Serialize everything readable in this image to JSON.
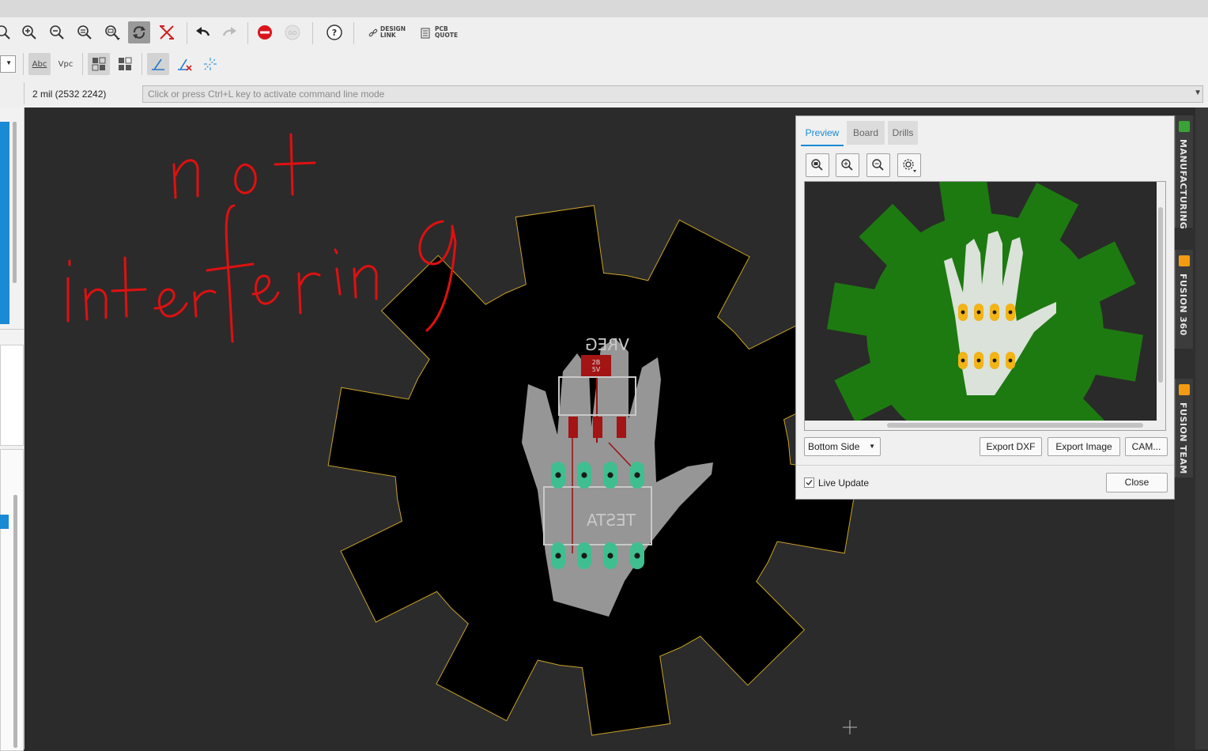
{
  "toolbar": {
    "design_link_line1": "DESIGN",
    "design_link_line2": "LINK",
    "pcb_quote_line1": "PCB",
    "pcb_quote_line2": "QUOTE",
    "help_label": "?",
    "abc_label": "Abc",
    "vpc_label": "Vpc"
  },
  "status": {
    "coordinates": "2 mil (2532 2242)",
    "command_placeholder": "Click or press Ctrl+L key to activate command line mode"
  },
  "annotation": {
    "line1": "not",
    "line2": "interfering"
  },
  "board": {
    "part_vreg_label": "VREG",
    "part_testa_label": "TESTA",
    "regulator_text_1": "2B",
    "regulator_text_2": "5V"
  },
  "dialog": {
    "tabs": [
      "Preview",
      "Board",
      "Drills"
    ],
    "active_tab": "Preview",
    "side_select": "Bottom Side",
    "export_dxf": "Export DXF",
    "export_image": "Export Image",
    "cam": "CAM...",
    "live_update_label": "Live Update",
    "live_update_checked": true,
    "close": "Close"
  },
  "side_tabs": [
    {
      "label": "MANUFACTURING",
      "icon": "manufacturing-icon",
      "color": "#3aa335"
    },
    {
      "label": "FUSION 360",
      "icon": "fusion-360-icon",
      "color": "#f39c12"
    },
    {
      "label": "FUSION TEAM",
      "icon": "fusion-team-icon",
      "color": "#f39c12"
    }
  ],
  "colors": {
    "board_fill": "#000000",
    "board_outline": "#c9a227",
    "preview_board": "#1d7a10",
    "pad_green": "#3fbf8f",
    "pad_yellow": "#f2b416",
    "annotation_red": "#e01010",
    "accent_blue": "#1a8ad4"
  }
}
